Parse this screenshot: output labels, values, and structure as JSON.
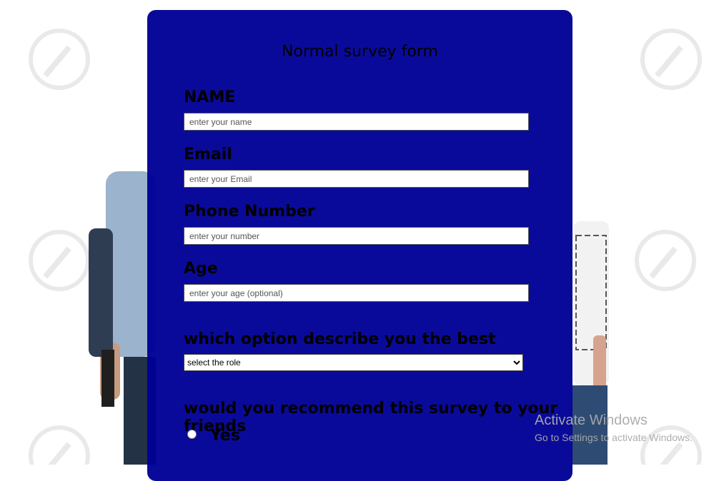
{
  "form": {
    "title": "Normal survey form",
    "name_label": "NAME",
    "name_placeholder": "enter your name",
    "email_label": "Email",
    "email_placeholder": "enter your Email",
    "phone_label": "Phone Number",
    "phone_placeholder": "enter your number",
    "age_label": "Age",
    "age_placeholder": "enter your age (optional)",
    "role_label": "which option describe you the best",
    "role_selected": "select the role",
    "recommend_label": "would you recommend this survey to your friends",
    "radio_yes": "Yes"
  },
  "os_notice": {
    "title": "Activate Windows",
    "subtitle": "Go to Settings to activate Windows."
  },
  "colors": {
    "card": "#000096",
    "background": "#ffffff"
  }
}
